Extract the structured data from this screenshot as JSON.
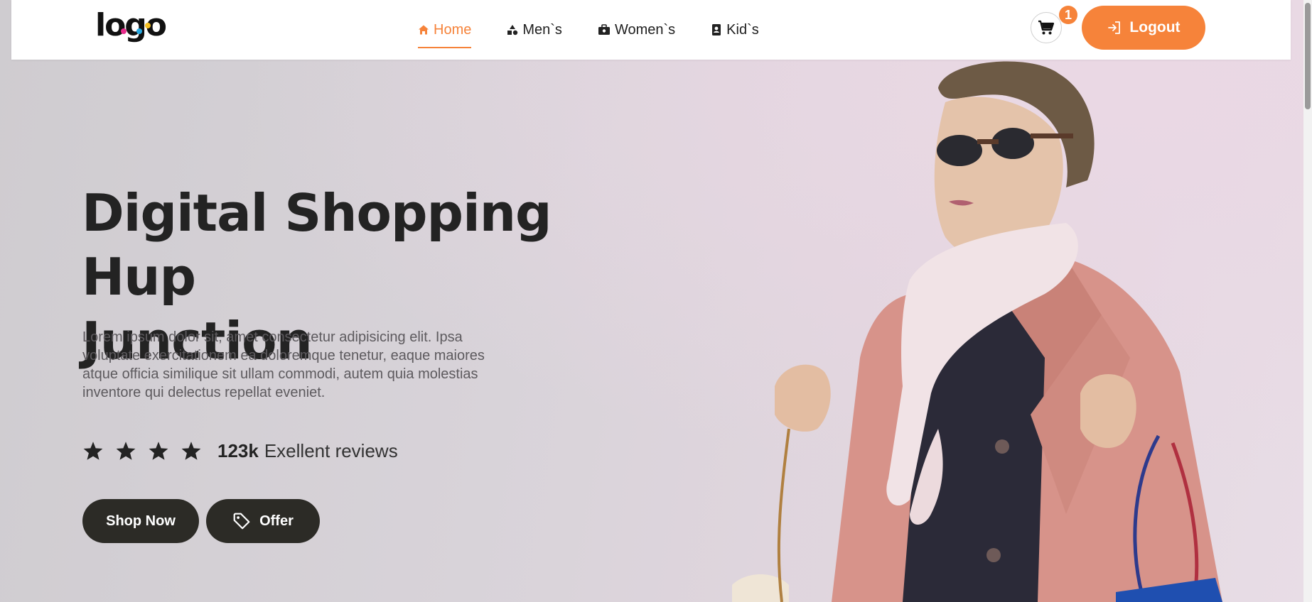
{
  "navbar": {
    "logo_text": "logo",
    "items": [
      {
        "label": "Home",
        "icon": "home-icon",
        "active": true
      },
      {
        "label": "Men`s",
        "icon": "shapes-icon",
        "active": false
      },
      {
        "label": "Women`s",
        "icon": "briefcase-icon",
        "active": false
      },
      {
        "label": "Kid`s",
        "icon": "contact-card-icon",
        "active": false
      }
    ],
    "cart_count": "1",
    "logout_label": "Logout"
  },
  "hero": {
    "title_line1": "Digital Shopping Hup",
    "title_line2": "Junction",
    "description": "Lorem ipsum dolor sit, amet consectetur adipisicing elit. Ipsa voluptate exercitationem ea doloremque tenetur, eaque maiores atque officia similique sit ullam commodi, autem quia molestias inventore qui delectus repellat eveniet.",
    "rating_stars": 4,
    "review_count": "123k",
    "review_label": "Exellent reviews",
    "shop_now_label": "Shop Now",
    "offer_label": "Offer"
  },
  "colors": {
    "accent": "#f6833a",
    "dark_button": "#2c2b26",
    "title_text": "#232323"
  }
}
